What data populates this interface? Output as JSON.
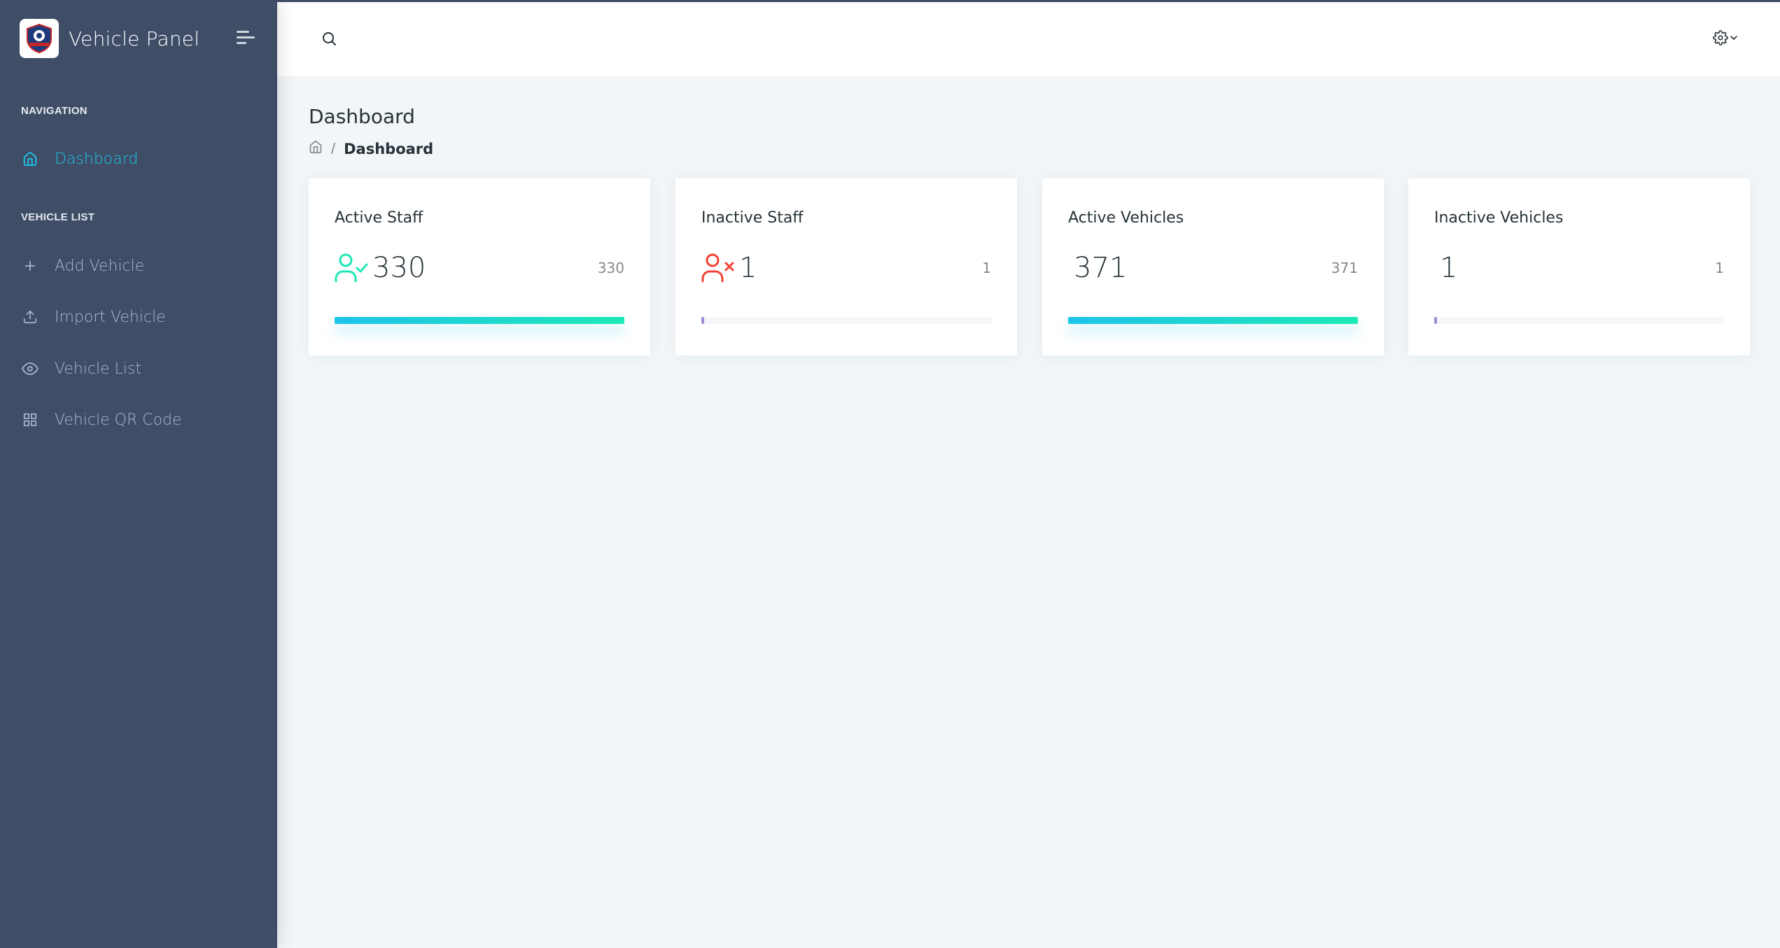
{
  "app": {
    "title": "Vehicle Panel"
  },
  "sidebar": {
    "sections": [
      {
        "caption": "NAVIGATION",
        "items": [
          {
            "label": "Dashboard",
            "icon": "home-icon",
            "active": true
          }
        ]
      },
      {
        "caption": "VEHICLE LIST",
        "items": [
          {
            "label": "Add Vehicle",
            "icon": "plus-icon"
          },
          {
            "label": "Import Vehicle",
            "icon": "upload-icon"
          },
          {
            "label": "Vehicle List",
            "icon": "eye-icon"
          },
          {
            "label": "Vehicle QR Code",
            "icon": "grid-icon"
          }
        ]
      }
    ]
  },
  "header": {
    "search_icon": "search-icon",
    "settings_icon": "gear-icon"
  },
  "page": {
    "title": "Dashboard",
    "breadcrumb": {
      "home_icon": "home-icon",
      "separator": "/",
      "current": "Dashboard"
    }
  },
  "cards": [
    {
      "title": "Active Staff",
      "value": "330",
      "count": "330",
      "icon": "user-check-icon",
      "progress": 1.0
    },
    {
      "title": "Inactive Staff",
      "value": "1",
      "count": "1",
      "icon": "user-x-icon",
      "progress": 0.01
    },
    {
      "title": "Active Vehicles",
      "value": "371",
      "count": "371",
      "progress": 1.0
    },
    {
      "title": "Inactive Vehicles",
      "value": "1",
      "count": "1",
      "progress": 0.01
    }
  ],
  "colors": {
    "sidebar": "#3f4d67",
    "accent": "#1dc4e9",
    "accent_end": "#1de9b6",
    "success": "#1de9b6",
    "danger": "#f44236",
    "progress_low": "#a389d4"
  }
}
